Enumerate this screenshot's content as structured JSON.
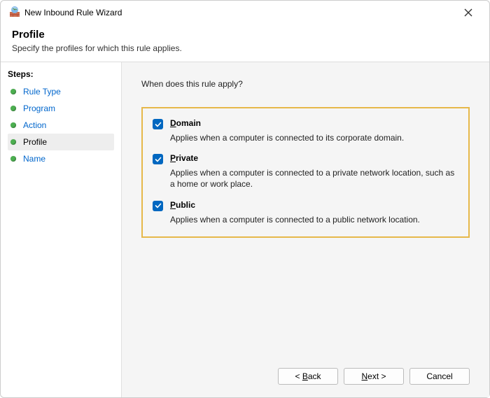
{
  "window": {
    "title": "New Inbound Rule Wizard"
  },
  "header": {
    "title": "Profile",
    "subtitle": "Specify the profiles for which this rule applies."
  },
  "sidebar": {
    "title": "Steps:",
    "items": [
      {
        "label": "Rule Type",
        "active": false
      },
      {
        "label": "Program",
        "active": false
      },
      {
        "label": "Action",
        "active": false
      },
      {
        "label": "Profile",
        "active": true
      },
      {
        "label": "Name",
        "active": false
      }
    ]
  },
  "content": {
    "question": "When does this rule apply?",
    "options": [
      {
        "key": "D",
        "rest": "omain",
        "checked": true,
        "desc": "Applies when a computer is connected to its corporate domain."
      },
      {
        "key": "P",
        "rest": "rivate",
        "checked": true,
        "desc": "Applies when a computer is connected to a private network location, such as a home or work place."
      },
      {
        "key": "P",
        "rest": "ublic",
        "checked": true,
        "desc": "Applies when a computer is connected to a public network location."
      }
    ]
  },
  "footer": {
    "back": {
      "lt": "< ",
      "key": "B",
      "rest": "ack"
    },
    "next": {
      "key": "N",
      "rest": "ext >"
    },
    "cancel": "Cancel"
  }
}
